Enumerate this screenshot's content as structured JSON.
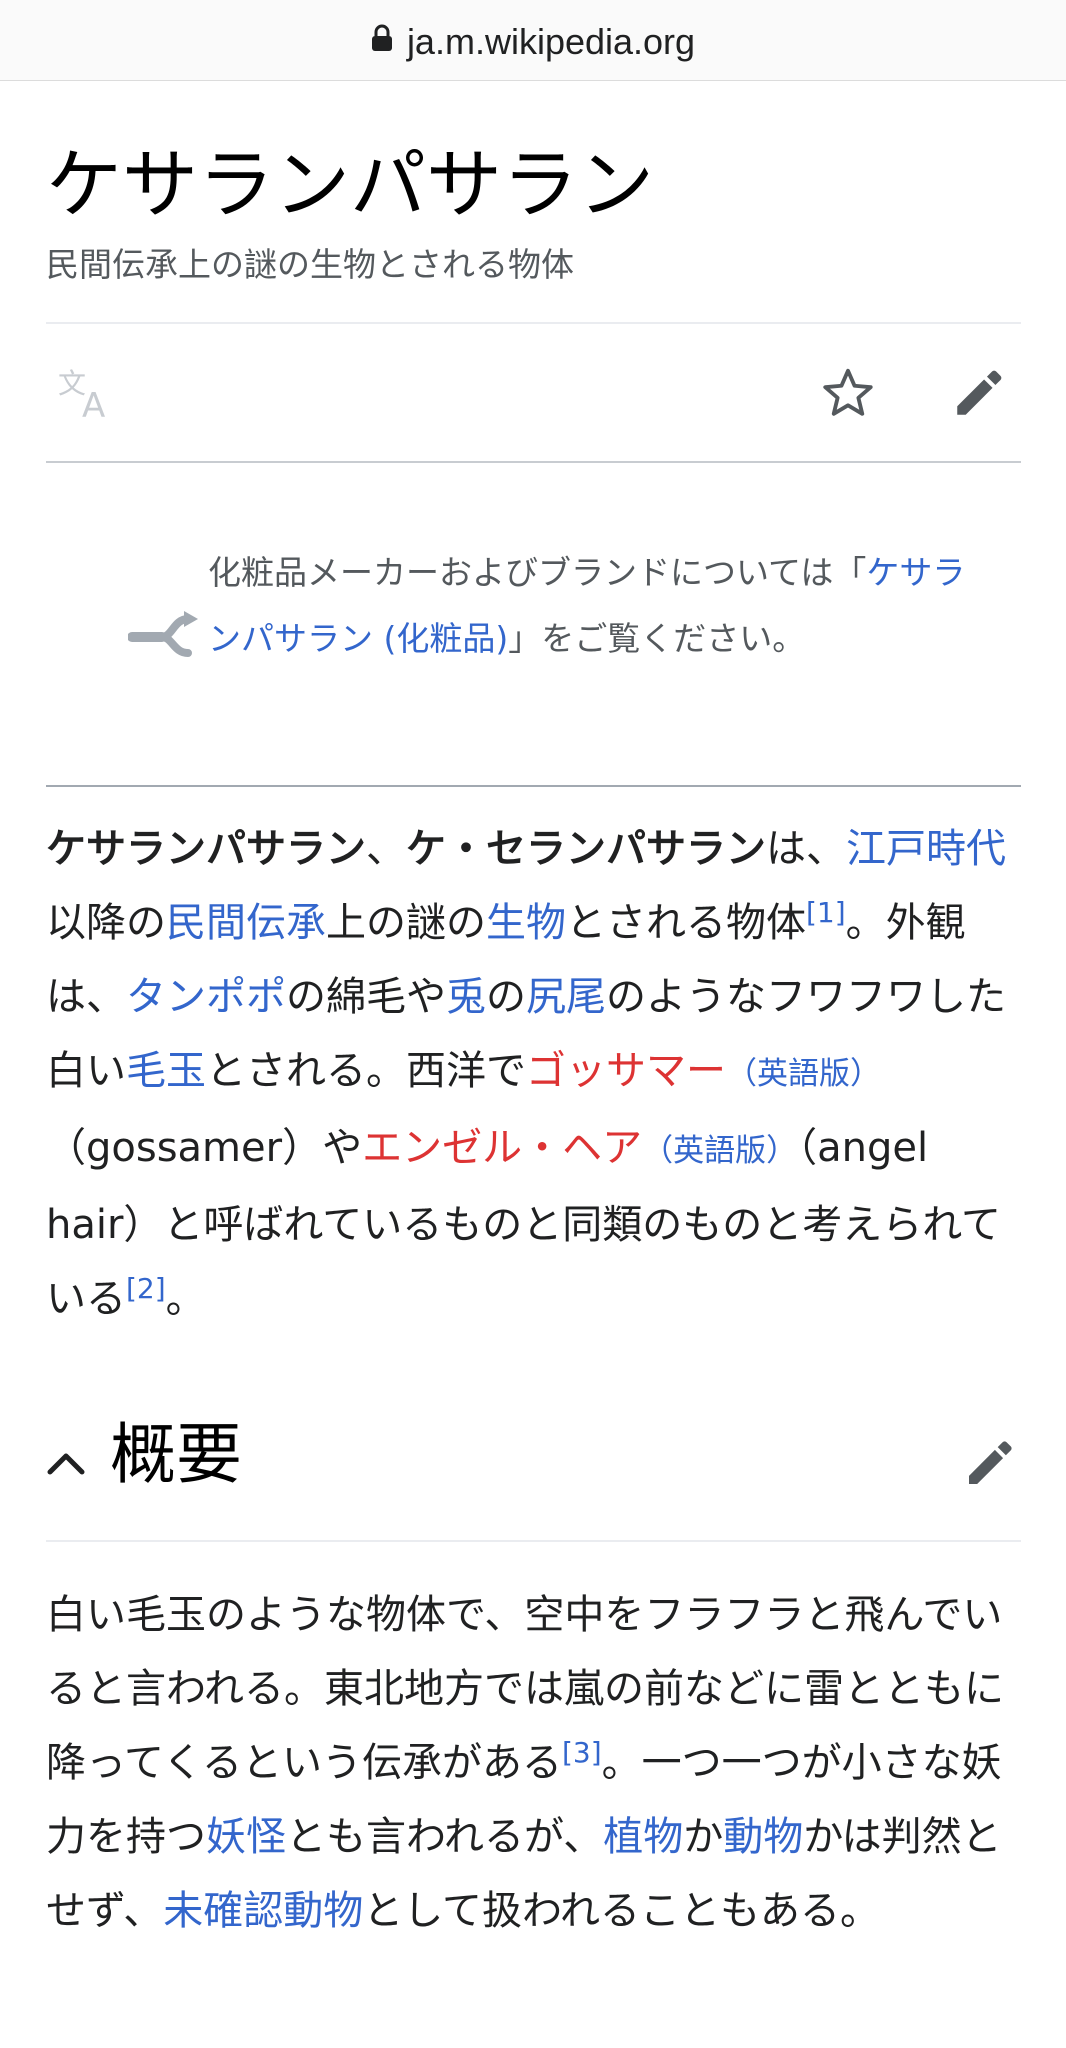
{
  "browser": {
    "url": "ja.m.wikipedia.org"
  },
  "article": {
    "title": "ケサランパサラン",
    "description": "民間伝承上の謎の生物とされる物体"
  },
  "toolbar": {
    "language_icon": "translate-icon",
    "watch_icon": "star-icon",
    "edit_icon": "pencil-icon"
  },
  "hatnote": {
    "text_before": "化粧品メーカーおよびブランドについては「",
    "link": "ケサランパサラン (化粧品)",
    "text_after": "」をご覧ください。",
    "icon": "disambiguation-fork-icon"
  },
  "lead": {
    "b1": "ケサランパサラン",
    "t1": "、",
    "b2": "ケ・セランパサラン",
    "t2": "は、",
    "l_edo": "江戸時代",
    "t3": "以降の",
    "l_folklore": "民間伝承",
    "t4": "上の謎の",
    "l_organism": "生物",
    "t5": "とされる物体",
    "ref1": "[1]",
    "t6": "。外観は、",
    "l_dandelion": "タンポポ",
    "t7": "の綿毛や",
    "l_rabbit": "兎",
    "t8": "の",
    "l_tail": "尻尾",
    "t9": "のようなフワフワした白い",
    "l_hairball": "毛玉",
    "t10": "とされる。西洋で",
    "r_gossamer": "ゴッサマー",
    "e1_open": "（",
    "e1_link": "英語版",
    "e1_close": "）",
    "t11": "（gossamer）や",
    "r_angel": "エンゼル・ヘア",
    "e2_open": "（",
    "e2_link": "英語版",
    "e2_close": "）",
    "t12": "（angel hair）と呼ばれているものと同類のものと考えられている",
    "ref2": "[2]",
    "t13": "。"
  },
  "section": {
    "heading": "概要",
    "chevron_icon": "chevron-up-icon",
    "edit_icon": "pencil-icon",
    "body": {
      "t1": "白い毛玉のような物体で、空中をフラフラと飛んでいると言われる。東北地方では嵐の前などに雷とともに降ってくるという伝承がある",
      "ref3": "[3]",
      "t2": "。一つ一つが小さな妖力を持つ",
      "l_yokai": "妖怪",
      "t3": "とも言われるが、",
      "l_plant": "植物",
      "t4": "か",
      "l_animal": "動物",
      "t5": "かは判然とせず、",
      "l_cryptid": "未確認動物",
      "t6": "として扱われることもある。"
    }
  },
  "colors": {
    "link": "#3366cc",
    "redlink": "#d33",
    "text": "#202122",
    "muted": "#54595d"
  }
}
